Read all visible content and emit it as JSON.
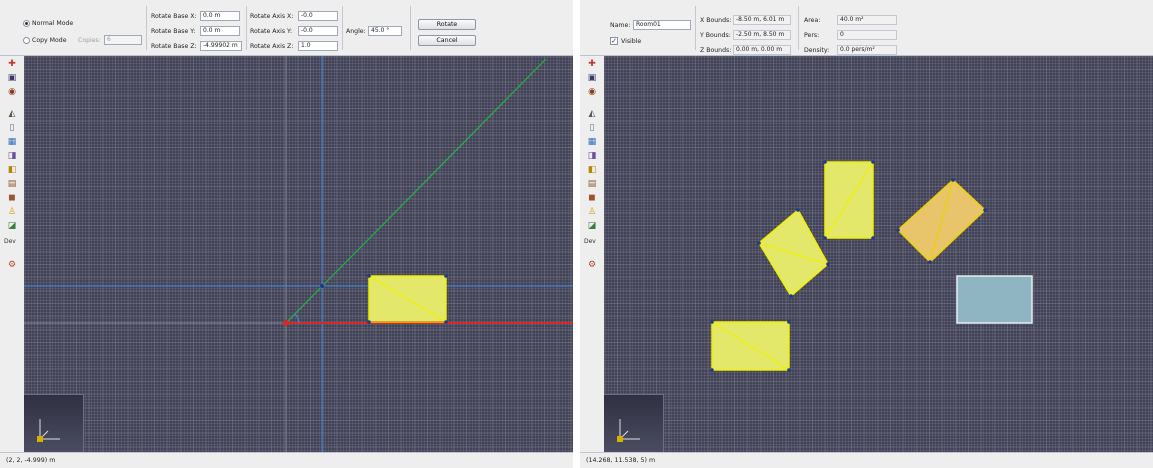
{
  "left": {
    "mode": {
      "normal_label": "Normal Mode",
      "copy_label": "Copy Mode",
      "copies_label": "Copies:",
      "copies_value": "6"
    },
    "rotate_base": {
      "x_label": "Rotate Base X:",
      "x_value": "0.0 m",
      "y_label": "Rotate Base Y:",
      "y_value": "0.0 m",
      "z_label": "Rotate Base Z:",
      "z_value": "-4.99902 m"
    },
    "rotate_axis": {
      "x_label": "Rotate Axis X:",
      "x_value": "-0.0",
      "y_label": "Rotate Axis Y:",
      "y_value": "-0.0",
      "z_label": "Rotate Axis Z:",
      "z_value": "1.0"
    },
    "angle_label": "Angle:",
    "angle_value": "45.0 °",
    "rotate_button": "Rotate",
    "cancel_button": "Cancel",
    "status": "(2, 2, -4.999) m"
  },
  "right": {
    "name_label": "Name:",
    "name_value": "Room01",
    "visible_label": "Visible",
    "x_bounds_label": "X Bounds:",
    "x_bounds_value": "-8.50 m, 6.01 m",
    "y_bounds_label": "Y Bounds:",
    "y_bounds_value": "-2.50 m, 8.50 m",
    "z_bounds_label": "Z Bounds:",
    "z_bounds_value": "0.00 m, 0.00 m",
    "area_label": "Area:",
    "area_value": "40.0 m²",
    "pers_label": "Pers:",
    "pers_value": "0",
    "density_label": "Density:",
    "density_value": "0.0 pers/m²",
    "status": "(14.268, 11.538, 5) m"
  },
  "palette": {
    "icons": [
      "move-icon",
      "select-icon",
      "globe-icon",
      "wall-icon",
      "door-icon",
      "window-icon",
      "stair-icon",
      "room-icon",
      "furniture-icon",
      "object-icon",
      "person-icon",
      "group-icon"
    ],
    "dev_label": "Dev",
    "extra_icon": "settings-icon"
  },
  "colors": {
    "canvas_bg": "#3f4053",
    "room_fill": "#e3e86a",
    "room_stroke": "#f0f000",
    "orange_room_fill": "#e8c56a",
    "teal_room_fill": "#8fb4c2",
    "axis_x": "#d62828",
    "axis_line": "#2aa84a",
    "guide_line": "#4a8be0"
  }
}
